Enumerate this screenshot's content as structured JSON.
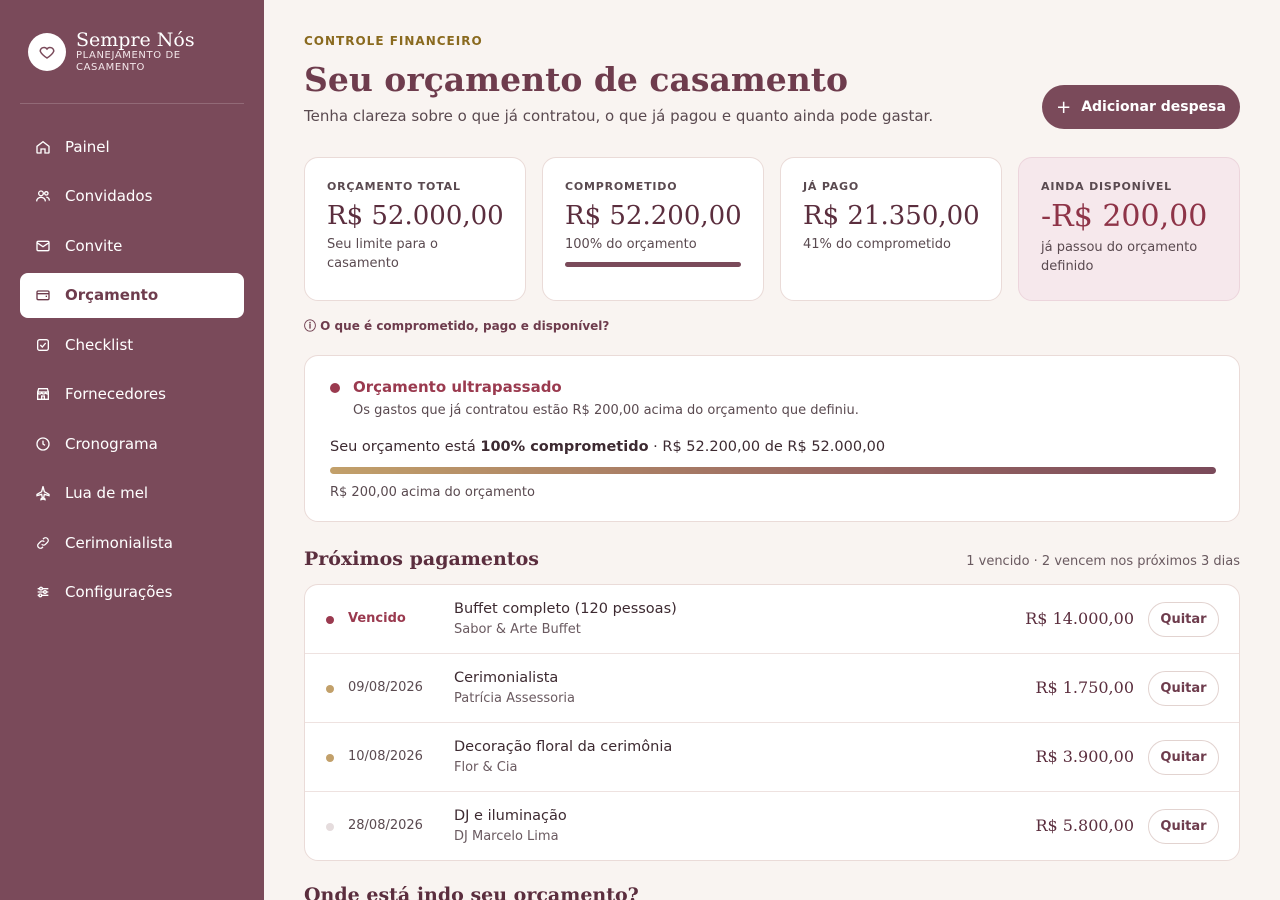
{
  "brand": {
    "name": "Sempre Nós",
    "subtitle": "PLANEJAMENTO DE CASAMENTO",
    "logo_icon": "heart-icon"
  },
  "sidebar": {
    "items": [
      {
        "label": "Painel",
        "icon": "home-icon",
        "active": false
      },
      {
        "label": "Convidados",
        "icon": "users-icon",
        "active": false
      },
      {
        "label": "Convite",
        "icon": "mail-icon",
        "active": false
      },
      {
        "label": "Orçamento",
        "icon": "wallet-icon",
        "active": true
      },
      {
        "label": "Checklist",
        "icon": "checkbox-icon",
        "active": false
      },
      {
        "label": "Fornecedores",
        "icon": "store-icon",
        "active": false
      },
      {
        "label": "Cronograma",
        "icon": "clock-icon",
        "active": false
      },
      {
        "label": "Lua de mel",
        "icon": "plane-icon",
        "active": false
      },
      {
        "label": "Cerimonialista",
        "icon": "link-icon",
        "active": false
      },
      {
        "label": "Configurações",
        "icon": "sliders-icon",
        "active": false
      }
    ]
  },
  "header": {
    "eyebrow": "CONTROLE FINANCEIRO",
    "title": "Seu orçamento de casamento",
    "subtitle": "Tenha clareza sobre o que já contratou, o que já pagou e quanto ainda pode gastar.",
    "add_button": "Adicionar despesa"
  },
  "summary_cards": [
    {
      "label": "ORÇAMENTO TOTAL",
      "value": "R$ 52.000,00",
      "note": "Seu limite para o casamento"
    },
    {
      "label": "COMPROMETIDO",
      "value": "R$ 52.200,00",
      "note": "100% do orçamento",
      "progress": 1.0
    },
    {
      "label": "JÁ PAGO",
      "value": "R$ 21.350,00",
      "note": "41% do comprometido"
    },
    {
      "label": "AINDA DISPONÍVEL",
      "value": "-R$ 200,00",
      "note": "já passou do orçamento definido"
    }
  ],
  "help_link": "ⓘ O que é comprometido, pago e disponível?",
  "alert": {
    "title": "Orçamento ultrapassado",
    "text": "Os gastos que já contratou estão R$ 200,00 acima do orçamento que definiu.",
    "summary_prefix": "Seu orçamento está ",
    "summary_bold": "100% comprometido",
    "summary_suffix": " · R$ 52.200,00 de R$ 52.000,00",
    "progress": 1.0,
    "footer": "R$ 200,00 acima do orçamento"
  },
  "payments": {
    "title": "Próximos pagamentos",
    "meta": "1 vencido · 2 vencem nos próximos 3 dias",
    "action_label": "Quitar",
    "rows": [
      {
        "date": "Vencido",
        "status": "overdue",
        "dot_color": "#9a3a4f",
        "name": "Buffet completo (120 pessoas)",
        "vendor": "Sabor & Arte Buffet",
        "amount": "R$ 14.000,00"
      },
      {
        "date": "09/08/2026",
        "status": "soon",
        "dot_color": "#c2a06a",
        "name": "Cerimonialista",
        "vendor": "Patrícia Assessoria",
        "amount": "R$ 1.750,00"
      },
      {
        "date": "10/08/2026",
        "status": "soon",
        "dot_color": "#c2a06a",
        "name": "Decoração floral da cerimônia",
        "vendor": "Flor & Cia",
        "amount": "R$ 3.900,00"
      },
      {
        "date": "28/08/2026",
        "status": "later",
        "dot_color": "#e5dcdd",
        "name": "DJ e iluminação",
        "vendor": "DJ Marcelo Lima",
        "amount": "R$ 5.800,00"
      }
    ]
  },
  "next_section_title": "Onde está indo seu orçamento?"
}
